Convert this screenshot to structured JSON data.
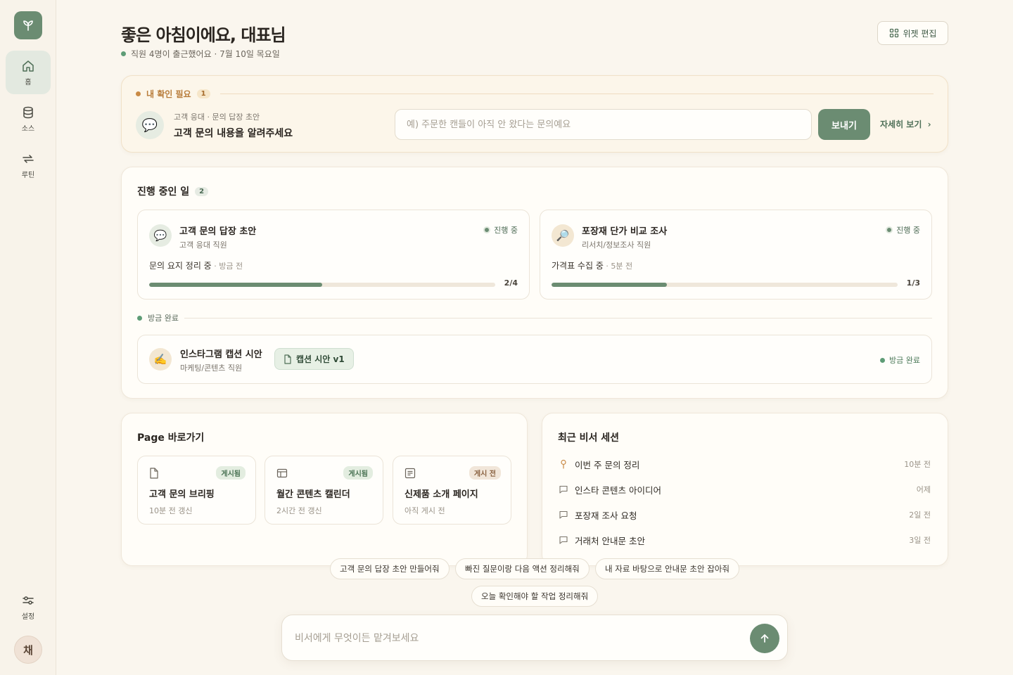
{
  "sidebar": {
    "items": [
      {
        "label": "홈"
      },
      {
        "label": "소스"
      },
      {
        "label": "루틴"
      }
    ],
    "settings_label": "설정",
    "avatar_initial": "채"
  },
  "header": {
    "title": "좋은 아침이에요, 대표님",
    "subtitle": "직원 4명이 출근했어요 · 7월 10일 목요일",
    "widget_edit_label": "위젯 편집"
  },
  "needs_review": {
    "label": "내 확인 필요",
    "count": "1",
    "item_sub": "고객 응대 · 문의 답장 초안",
    "item_title": "고객 문의 내용을 알려주세요",
    "input_placeholder": "예) 주문한 캔들이 아직 안 왔다는 문의예요",
    "send_label": "보내기",
    "detail_label": "자세히 보기"
  },
  "in_progress": {
    "title": "진행 중인 일",
    "count": "2",
    "tasks": [
      {
        "title": "고객 문의 답장 초안",
        "role": "고객 응대 직원",
        "status": "진행 중",
        "step": "문의 요지 정리 중",
        "time": " · 방금 전",
        "progress_text": "2/4",
        "progress": 0.5
      },
      {
        "title": "포장재 단가 비교 조사",
        "role": "리서치/정보조사 직원",
        "status": "진행 중",
        "step": "가격표 수집 중",
        "time": " · 5분 전",
        "progress_text": "1/3",
        "progress": 0.333
      }
    ],
    "recent_done_label": "방금 완료",
    "done": {
      "title": "인스타그램 캡션 시안",
      "role": "마케팅/콘텐츠 직원",
      "doc_label": "캡션 시안 v1",
      "status": "방금 완료"
    }
  },
  "pages": {
    "title": "Page 바로가기",
    "items": [
      {
        "title": "고객 문의 브리핑",
        "meta": "10분 전 갱신",
        "badge": "게시됨"
      },
      {
        "title": "월간 콘텐츠 캘린더",
        "meta": "2시간 전 갱신",
        "badge": "게시됨"
      },
      {
        "title": "신제품 소개 페이지",
        "meta": "아직 게시 전",
        "badge": "게시 전"
      }
    ]
  },
  "sessions": {
    "title": "최근 비서 세션",
    "items": [
      {
        "title": "이번 주 문의 정리",
        "time": "10분 전"
      },
      {
        "title": "인스타 콘텐츠 아이디어",
        "time": "어제"
      },
      {
        "title": "포장재 조사 요청",
        "time": "2일 전"
      },
      {
        "title": "거래처 안내문 초안",
        "time": "3일 전"
      }
    ]
  },
  "suggestions": [
    "고객 문의 답장 초안 만들어줘",
    "빠진 질문이랑 다음 액션 정리해줘",
    "내 자료 바탕으로 안내문 초안 잡아줘",
    "오늘 확인해야 할 작업 정리해줘"
  ],
  "composer": {
    "placeholder": "비서에게 무엇이든 맡겨보세요"
  },
  "colors": {
    "accent": "#6b8c72",
    "background": "#faf6ee",
    "warning": "#c98a46",
    "success": "#5e9c76"
  }
}
